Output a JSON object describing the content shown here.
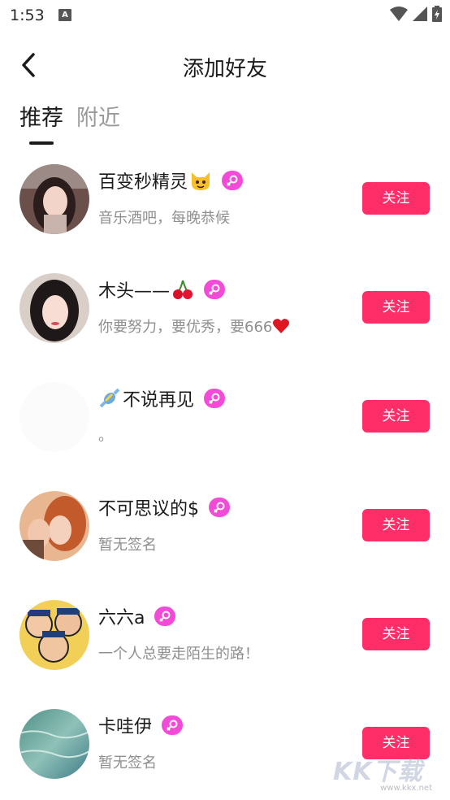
{
  "status_bar": {
    "time": "1:53",
    "notification_icon": "a-icon"
  },
  "nav": {
    "back_icon": "chevron-left-icon",
    "title": "添加好友"
  },
  "tabs": [
    {
      "label": "推荐",
      "active": true
    },
    {
      "label": "附近",
      "active": false
    }
  ],
  "users": [
    {
      "name": "百变秒精灵",
      "name_prefix_emoji": "",
      "name_suffix_emoji": "cat-face-icon",
      "signature": "音乐酒吧，每晚恭候",
      "signature_emoji": "",
      "gender": "female-icon",
      "follow_label": "关注"
    },
    {
      "name": "木头——",
      "name_prefix_emoji": "",
      "name_suffix_emoji": "cherries-icon",
      "signature": "你要努力，要优秀，要666",
      "signature_emoji": "red-heart-icon",
      "gender": "female-icon",
      "follow_label": "关注"
    },
    {
      "name": "不说再见",
      "name_prefix_emoji": "candy-icon",
      "name_suffix_emoji": "",
      "signature": "。",
      "signature_emoji": "",
      "gender": "female-icon",
      "follow_label": "关注"
    },
    {
      "name": "不可思议的$",
      "name_prefix_emoji": "",
      "name_suffix_emoji": "",
      "signature": "暂无签名",
      "signature_emoji": "",
      "gender": "female-icon",
      "follow_label": "关注"
    },
    {
      "name": "六六a",
      "name_prefix_emoji": "",
      "name_suffix_emoji": "",
      "signature": "一个人总要走陌生的路！",
      "signature_emoji": "",
      "gender": "female-icon",
      "follow_label": "关注"
    },
    {
      "name": "卡哇伊",
      "name_prefix_emoji": "",
      "name_suffix_emoji": "",
      "signature": "暂无签名",
      "signature_emoji": "",
      "gender": "female-icon",
      "follow_label": "关注"
    }
  ],
  "watermark": {
    "text": "KK下载",
    "url": "www.kkx.net"
  },
  "colors": {
    "follow_button": "#ff2d68",
    "gender_badge": "#f34bd7",
    "signature": "#8f8f8f"
  }
}
